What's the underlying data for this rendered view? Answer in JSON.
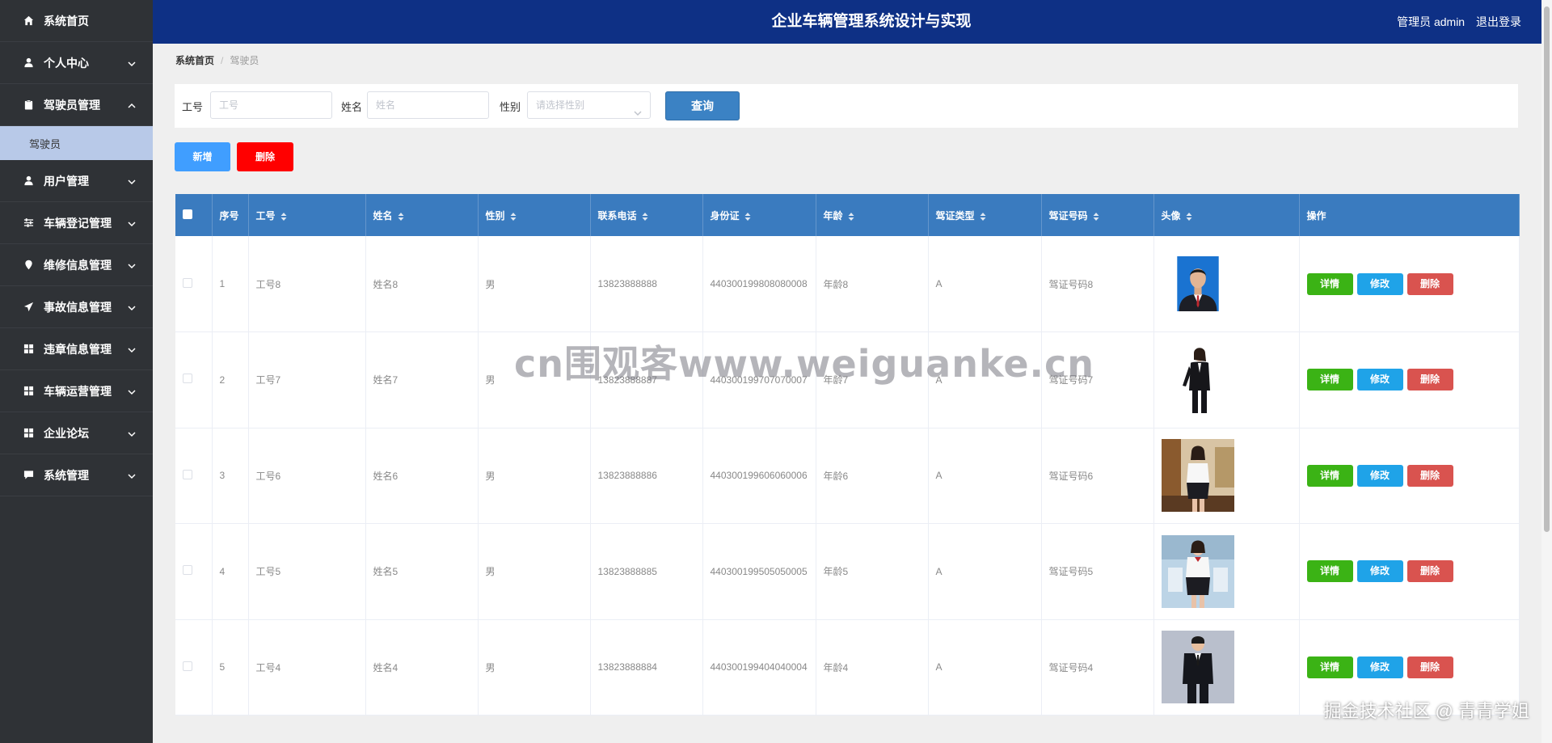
{
  "header": {
    "title": "企业车辆管理系统设计与实现",
    "user": "管理员 admin",
    "logout": "退出登录"
  },
  "sidebar": {
    "items": [
      {
        "label": "系统首页",
        "icon": "home-icon",
        "chevron": ""
      },
      {
        "label": "个人中心",
        "icon": "user-icon",
        "chevron": "down"
      },
      {
        "label": "驾驶员管理",
        "icon": "clipboard-icon",
        "chevron": "up"
      },
      {
        "label": "用户管理",
        "icon": "user-icon",
        "chevron": "down"
      },
      {
        "label": "车辆登记管理",
        "icon": "sliders-icon",
        "chevron": "down"
      },
      {
        "label": "维修信息管理",
        "icon": "map-pin-icon",
        "chevron": "down"
      },
      {
        "label": "事故信息管理",
        "icon": "send-icon",
        "chevron": "down"
      },
      {
        "label": "违章信息管理",
        "icon": "grid-icon",
        "chevron": "down"
      },
      {
        "label": "车辆运营管理",
        "icon": "grid-icon",
        "chevron": "down"
      },
      {
        "label": "企业论坛",
        "icon": "grid-icon",
        "chevron": "down"
      },
      {
        "label": "系统管理",
        "icon": "comment-icon",
        "chevron": "down"
      }
    ],
    "submenu": {
      "label": "驾驶员"
    }
  },
  "breadcrumb": {
    "home": "系统首页",
    "separator": "/",
    "current": "驾驶员"
  },
  "search": {
    "gonghao_label": "工号",
    "gonghao_placeholder": "工号",
    "name_label": "姓名",
    "name_placeholder": "姓名",
    "gender_label": "性别",
    "gender_placeholder": "请选择性别",
    "query_button": "查询"
  },
  "actions": {
    "add": "新增",
    "delete": "删除"
  },
  "table": {
    "headers": [
      "序号",
      "工号",
      "姓名",
      "性别",
      "联系电话",
      "身份证",
      "年龄",
      "驾证类型",
      "驾证号码",
      "头像",
      "操作"
    ],
    "row_buttons": {
      "detail": "详情",
      "edit": "修改",
      "delete": "删除"
    },
    "rows": [
      {
        "index": "1",
        "gonghao": "工号8",
        "name": "姓名8",
        "gender": "男",
        "phone": "13823888888",
        "idcard": "440300199808080008",
        "age": "年龄8",
        "license_type": "A",
        "license_no": "驾证号码8",
        "avatar": "man-formal"
      },
      {
        "index": "2",
        "gonghao": "工号7",
        "name": "姓名7",
        "gender": "男",
        "phone": "13823888887",
        "idcard": "440300199707070007",
        "age": "年龄7",
        "license_type": "A",
        "license_no": "驾证号码7",
        "avatar": "woman-suit"
      },
      {
        "index": "3",
        "gonghao": "工号6",
        "name": "姓名6",
        "gender": "男",
        "phone": "13823888886",
        "idcard": "440300199606060006",
        "age": "年龄6",
        "license_type": "A",
        "license_no": "驾证号码6",
        "avatar": "woman-office"
      },
      {
        "index": "4",
        "gonghao": "工号5",
        "name": "姓名5",
        "gender": "男",
        "phone": "13823888885",
        "idcard": "440300199505050005",
        "age": "年龄5",
        "license_type": "A",
        "license_no": "驾证号码5",
        "avatar": "woman-uniform"
      },
      {
        "index": "5",
        "gonghao": "工号4",
        "name": "姓名4",
        "gender": "男",
        "phone": "13823888884",
        "idcard": "440300199404040004",
        "age": "年龄4",
        "license_type": "A",
        "license_no": "驾证号码4",
        "avatar": "man-suit"
      }
    ]
  },
  "watermark": "cn围观客www.weiguanke.cn",
  "footer_watermark": "掘金技术社区 @ 青青学姐",
  "colors": {
    "header_bg": "#0e3085",
    "sidebar_bg": "#2f3236",
    "table_header": "#3a7bbf",
    "add_button": "#409eff",
    "delete_button": "#ff0000",
    "detail_button": "#3bb315",
    "edit_button": "#1fa3e8",
    "row_delete_button": "#d9534f"
  }
}
